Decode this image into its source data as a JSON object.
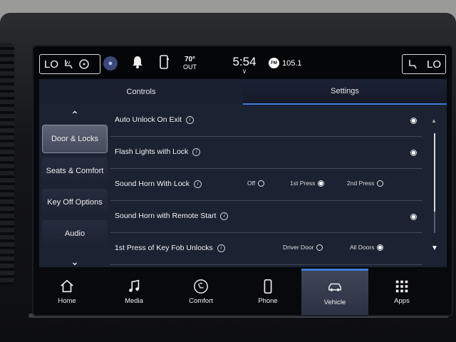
{
  "status": {
    "left_climate": "LO",
    "right_climate": "LO",
    "temperature": "70°",
    "temperature_unit": "OUT",
    "clock": "5:54",
    "radio_band": "FM",
    "radio_station": "105.1"
  },
  "tabs": [
    {
      "label": "Controls",
      "active": false
    },
    {
      "label": "Settings",
      "active": true
    }
  ],
  "sidebar": {
    "items": [
      {
        "label": "Door & Locks",
        "active": true
      },
      {
        "label": "Seats & Comfort",
        "active": false
      },
      {
        "label": "Key Off Options",
        "active": false
      },
      {
        "label": "Audio",
        "active": false
      }
    ]
  },
  "settings": {
    "rows": [
      {
        "label": "Auto Unlock On Exit",
        "selected": true
      },
      {
        "label": "Flash Lights with Lock",
        "selected": true
      },
      {
        "label": "Sound Horn With Lock",
        "options": [
          "Off",
          "1st Press",
          "2nd Press"
        ],
        "selected_option": "1st Press"
      },
      {
        "label": "Sound Horn with Remote Start",
        "selected": true
      },
      {
        "label": "1st Press of Key Fob Unlocks",
        "options": [
          "Driver Door",
          "All Doors"
        ],
        "selected_option": "All Doors"
      }
    ]
  },
  "nav": {
    "items": [
      {
        "label": "Home",
        "icon": "home-icon",
        "active": false
      },
      {
        "label": "Media",
        "icon": "music-note-icon",
        "active": false
      },
      {
        "label": "Comfort",
        "icon": "comfort-icon",
        "active": false
      },
      {
        "label": "Phone",
        "icon": "phone-icon",
        "active": false
      },
      {
        "label": "Vehicle",
        "icon": "car-icon",
        "active": true
      },
      {
        "label": "Apps",
        "icon": "apps-grid-icon",
        "active": false
      }
    ]
  },
  "colors": {
    "accent": "#3d7cd8",
    "panel": "#1b2232"
  }
}
